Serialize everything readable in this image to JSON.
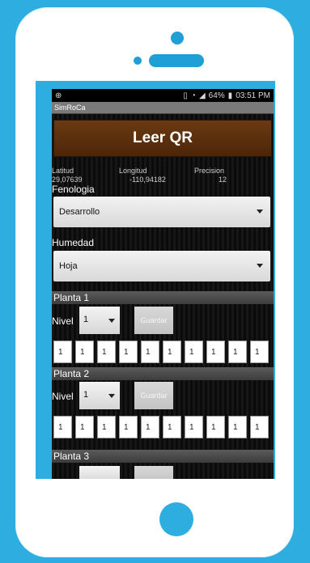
{
  "statusbar": {
    "icons": [
      "gps-icon",
      "vibrate-icon",
      "wifi-icon",
      "signal-icon",
      "battery-icon"
    ],
    "battery": "64%",
    "time": "03:51 PM"
  },
  "app": {
    "title": "SimRoCa"
  },
  "qr_button": {
    "label": "Leer QR"
  },
  "coords": {
    "lat_label": "Latitud",
    "lat_value": "29,07639",
    "lon_label": "Longitud",
    "lon_value": "-110,94182",
    "prec_label": "Precision",
    "prec_value": "12"
  },
  "fenologia": {
    "label": "Fenologia",
    "value": "Desarrollo"
  },
  "humedad": {
    "label": "Humedad",
    "value": "Hoja"
  },
  "plantas": [
    {
      "title": "Planta 1",
      "nivel_label": "Nivel",
      "nivel_value": "1",
      "save_label": "Guardar",
      "values": [
        "1",
        "1",
        "1",
        "1",
        "1",
        "1",
        "1",
        "1",
        "1",
        "1"
      ]
    },
    {
      "title": "Planta 2",
      "nivel_label": "Nivel",
      "nivel_value": "1",
      "save_label": "Guardar",
      "values": [
        "1",
        "1",
        "1",
        "1",
        "1",
        "1",
        "1",
        "1",
        "1",
        "1"
      ]
    },
    {
      "title": "Planta 3"
    }
  ],
  "colors": {
    "background": "#2eaee0",
    "header_button": "#5a2e0c"
  }
}
